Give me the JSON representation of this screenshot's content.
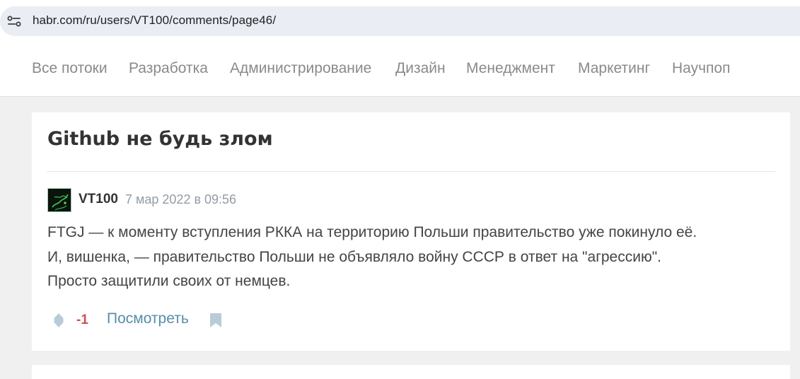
{
  "browser": {
    "url": "habr.com/ru/users/VT100/comments/page46/"
  },
  "nav": {
    "items": [
      "Все потоки",
      "Разработка",
      "Администрирование",
      "Дизайн",
      "Менеджмент",
      "Маркетинг",
      "Научпоп"
    ]
  },
  "post": {
    "title": "Github не будь злом",
    "comment": {
      "author": "VT100",
      "date": "7 мар 2022 в 09:56",
      "lines": [
        "FTGJ — к моменту вступления РККА на территорию Польши правительство уже покинуло её.",
        "И, вишенка, — правительство Польши не объявляло войну СССР в ответ на \"агрессию\".",
        "Просто защитили своих от немцев."
      ],
      "score": "-1",
      "view_label": "Посмотреть"
    }
  },
  "colors": {
    "accent": "#548eaa",
    "negative_score": "#d04e4e",
    "nav_text": "#8a8a8a"
  },
  "icons": {
    "site_info": "site-info-icon",
    "vote": "vote-icon",
    "bookmark": "bookmark-icon"
  }
}
